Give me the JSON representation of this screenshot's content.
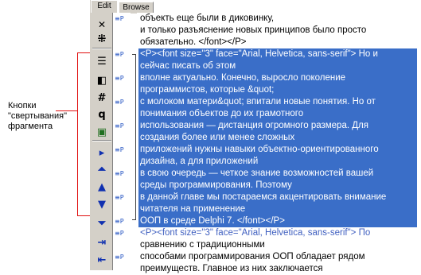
{
  "annotation": {
    "label": "Кнопки\n\"свертывания\"\nфрагмента"
  },
  "tabs": [
    {
      "label": "Edit"
    },
    {
      "label": "Browse"
    }
  ],
  "toolbar": [
    {
      "icon": "close-icon",
      "glyph": "✕"
    },
    {
      "icon": "unlink-icon",
      "glyph": "⁜"
    },
    {
      "icon": "collapse-block-icon",
      "glyph": "☰"
    },
    {
      "icon": "collapse-left-icon",
      "glyph": "◧"
    },
    {
      "icon": "hash-icon",
      "glyph": "#"
    },
    {
      "icon": "paragraph-icon",
      "glyph": "q"
    },
    {
      "icon": "monitor-icon",
      "glyph": "▣"
    },
    {
      "icon": "marker-right-icon",
      "glyph": "▸"
    },
    {
      "icon": "collapse-all-icon",
      "glyph": "⏶"
    },
    {
      "icon": "collapse-up-icon",
      "glyph": "▲"
    },
    {
      "icon": "collapse-down-icon",
      "glyph": "▼"
    },
    {
      "icon": "expand-all-icon",
      "glyph": "⏷"
    },
    {
      "icon": "indent-in-icon",
      "glyph": "⇥"
    },
    {
      "icon": "indent-out-icon",
      "glyph": "⇤"
    }
  ],
  "paragraph_mark": "≡P",
  "lines": [
    {
      "text": "объекть еще были в диковинку,",
      "kind": "normal"
    },
    {
      "text": "и только разъяснение новых принципов было просто",
      "kind": "normal"
    },
    {
      "text": "обязательно. </font></P>",
      "kind": "normal"
    },
    {
      "text": "<P><font size=\"3\" face=\"Arial, Helvetica, sans-serif\"> Но и",
      "kind": "sel"
    },
    {
      "text": "сейчас писать об этом",
      "kind": "sel"
    },
    {
      "text": "вполне актуально. Конечно, выросло поколение",
      "kind": "sel"
    },
    {
      "text": "программистов, которые &quot;",
      "kind": "sel"
    },
    {
      "text": "с молоком матери&quot; впитали новые понятия. Но от",
      "kind": "sel"
    },
    {
      "text": "понимания объектов до их грамотного",
      "kind": "sel"
    },
    {
      "text": "использования — дистанция огромного размера. Для",
      "kind": "sel"
    },
    {
      "text": "создания более или менее сложных",
      "kind": "sel"
    },
    {
      "text": "приложений нужны навыки объектно-ориентированного",
      "kind": "sel"
    },
    {
      "text": "дизайна, а для приложений",
      "kind": "sel"
    },
    {
      "text": "в свою очередь — четкое знание возможностей вашей",
      "kind": "sel"
    },
    {
      "text": "среды программирования. Поэтому",
      "kind": "sel"
    },
    {
      "text": "в данной главе мы постараемся акцентировать внимание",
      "kind": "sel"
    },
    {
      "text": "читателя на применение",
      "kind": "sel"
    },
    {
      "text": "ООП в среде Delphi 7. </font></P>",
      "kind": "sel"
    },
    {
      "text": "<P><font size=\"3\" face=\"Arial, Helvetica, sans-serif\"> По",
      "kind": "blue"
    },
    {
      "text": "сравнению с традиционными",
      "kind": "normal"
    },
    {
      "text": "способами программирования ООП обладает рядом",
      "kind": "normal"
    },
    {
      "text": "преимуществ. Главное из них заключается",
      "kind": "normal"
    }
  ]
}
